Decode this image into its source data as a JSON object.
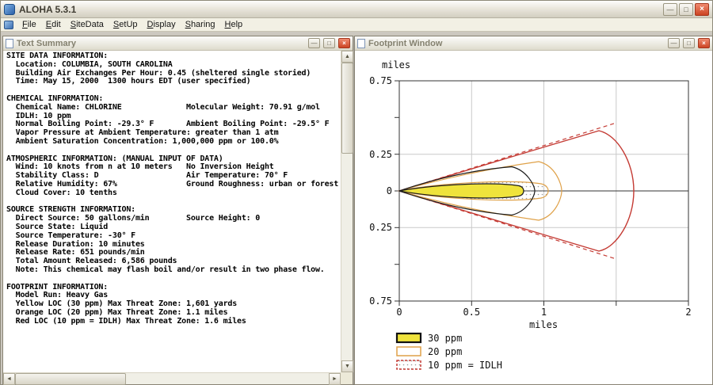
{
  "app": {
    "title": "ALOHA 5.3.1"
  },
  "icons": {
    "minimize": "—",
    "maximize": "□",
    "close": "×",
    "scroll_up": "▲",
    "scroll_down": "▼",
    "scroll_left": "◄",
    "scroll_right": "►"
  },
  "menu": {
    "items": [
      {
        "label": "File",
        "underline": 0
      },
      {
        "label": "Edit",
        "underline": 0
      },
      {
        "label": "SiteData",
        "underline": 0
      },
      {
        "label": "SetUp",
        "underline": 0
      },
      {
        "label": "Display",
        "underline": 0
      },
      {
        "label": "Sharing",
        "underline": 0
      },
      {
        "label": "Help",
        "underline": 0
      }
    ]
  },
  "text_summary": {
    "title": "Text Summary",
    "lines": [
      "SITE DATA INFORMATION:",
      "  Location: COLUMBIA, SOUTH CAROLINA",
      "  Building Air Exchanges Per Hour: 0.45 (sheltered single storied)",
      "  Time: May 15, 2000  1300 hours EDT (user specified)",
      "",
      "CHEMICAL INFORMATION:",
      "  Chemical Name: CHLORINE              Molecular Weight: 70.91 g/mol",
      "  IDLH: 10 ppm",
      "  Normal Boiling Point: -29.3° F       Ambient Boiling Point: -29.5° F",
      "  Vapor Pressure at Ambient Temperature: greater than 1 atm",
      "  Ambient Saturation Concentration: 1,000,000 ppm or 100.0%",
      "",
      "ATMOSPHERIC INFORMATION: (MANUAL INPUT OF DATA)",
      "  Wind: 10 knots from n at 10 meters   No Inversion Height",
      "  Stability Class: D                   Air Temperature: 70° F",
      "  Relative Humidity: 67%               Ground Roughness: urban or forest",
      "  Cloud Cover: 10 tenths",
      "",
      "SOURCE STRENGTH INFORMATION:",
      "  Direct Source: 50 gallons/min        Source Height: 0",
      "  Source State: Liquid",
      "  Source Temperature: -30° F",
      "  Release Duration: 10 minutes",
      "  Release Rate: 651 pounds/min",
      "  Total Amount Released: 6,586 pounds",
      "  Note: This chemical may flash boil and/or result in two phase flow.",
      "",
      "FOOTPRINT INFORMATION:",
      "  Model Run: Heavy Gas",
      "  Yellow LOC (30 ppm) Max Threat Zone: 1,601 yards",
      "  Orange LOC (20 ppm) Max Threat Zone: 1.1 miles",
      "  Red LOC (10 ppm = IDLH) Max Threat Zone: 1.6 miles"
    ]
  },
  "footprint": {
    "title": "Footprint Window",
    "axis_y": "miles",
    "axis_x": "miles",
    "y_ticks": [
      "0.75",
      "0.25",
      "0",
      "0.25",
      "0.75"
    ],
    "x_ticks": [
      "0",
      "0.5",
      "1",
      "2"
    ],
    "legend": [
      {
        "label": "30 ppm"
      },
      {
        "label": "20 ppm"
      },
      {
        "label": "10 ppm = IDLH"
      }
    ]
  },
  "colors": {
    "yellow_zone": "#efe33c",
    "orange_zone": "#dfa148",
    "red_zone": "#c43a33",
    "outline_black": "#1a1a1a"
  },
  "chart_data": {
    "type": "area",
    "title": "Footprint threat zones (top-down plume view)",
    "xlabel": "miles",
    "ylabel": "miles",
    "xlim": [
      0,
      2
    ],
    "ylim": [
      -0.75,
      0.75
    ],
    "x_tick_values": [
      0,
      0.5,
      1,
      1.5,
      2
    ],
    "y_tick_values": [
      -0.75,
      -0.25,
      0,
      0.25,
      0.75
    ],
    "grid": true,
    "legend_position": "bottom-left",
    "series": [
      {
        "name": "30 ppm",
        "color": "#efe33c",
        "style": "yellow filled plume with black outline and black confidence wedge",
        "max_downwind_miles": 0.9,
        "max_half_width_miles": 0.17
      },
      {
        "name": "20 ppm",
        "color": "#dfa148",
        "style": "orange outline plume with stippled fill and confidence wedge",
        "max_downwind_miles": 1.1,
        "max_half_width_miles": 0.24
      },
      {
        "name": "10 ppm = IDLH",
        "color": "#c43a33",
        "style": "red outline fan with dashed wind-direction confidence lines",
        "max_downwind_miles": 1.6,
        "max_half_width_miles": 0.45
      }
    ]
  }
}
